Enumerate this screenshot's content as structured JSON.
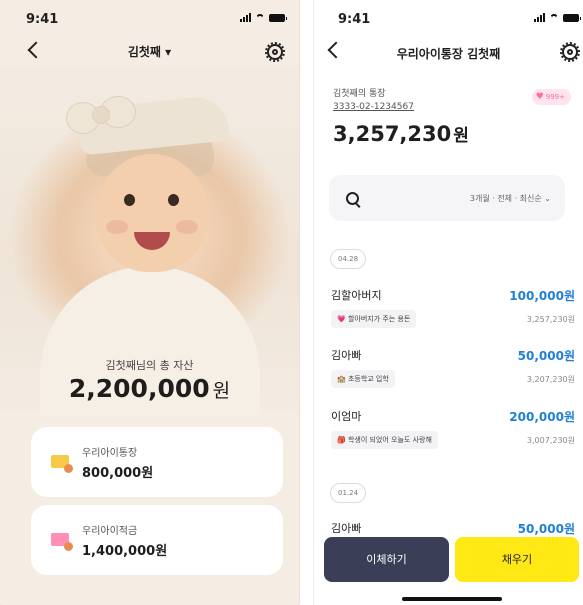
{
  "left": {
    "status_time": "9:41",
    "title": "김첫째 ▾",
    "total_label": "김첫째님의 총 자산",
    "total_amount": "2,200,000",
    "currency_unit": "원",
    "accounts": [
      {
        "label": "우리아이통장",
        "value": "800,000원",
        "icon_color": "#f7c948"
      },
      {
        "label": "우리아이적금",
        "value": "1,400,000원",
        "icon_color": "#ff8fb6"
      }
    ]
  },
  "right": {
    "status_time": "9:41",
    "title": "우리아이통장 김첫째",
    "account_owner": "김첫째의 통장",
    "account_number": "3333-02-1234567",
    "balance": "3,257,230",
    "currency_unit": "원",
    "badge": "999+",
    "filter": "3개월 · 전체 · 최신순 ⌄",
    "dates": [
      "04.28",
      "01.24"
    ],
    "transactions": [
      {
        "name": "김할아버지",
        "amount": "100,000원",
        "memo": "💗 할아버지가 주는 용돈",
        "balance": "3,257,230원"
      },
      {
        "name": "김아빠",
        "amount": "50,000원",
        "memo": "🏫 초등학교 입학",
        "balance": "3,207,230원"
      },
      {
        "name": "이엄마",
        "amount": "200,000원",
        "memo": "🎒 학생이 되었어 오늘도 사랑해",
        "balance": "3,007,230원"
      },
      {
        "name": "김아빠",
        "amount": "50,000원"
      }
    ],
    "buttons": {
      "transfer": "이체하기",
      "fill": "채우기"
    }
  }
}
